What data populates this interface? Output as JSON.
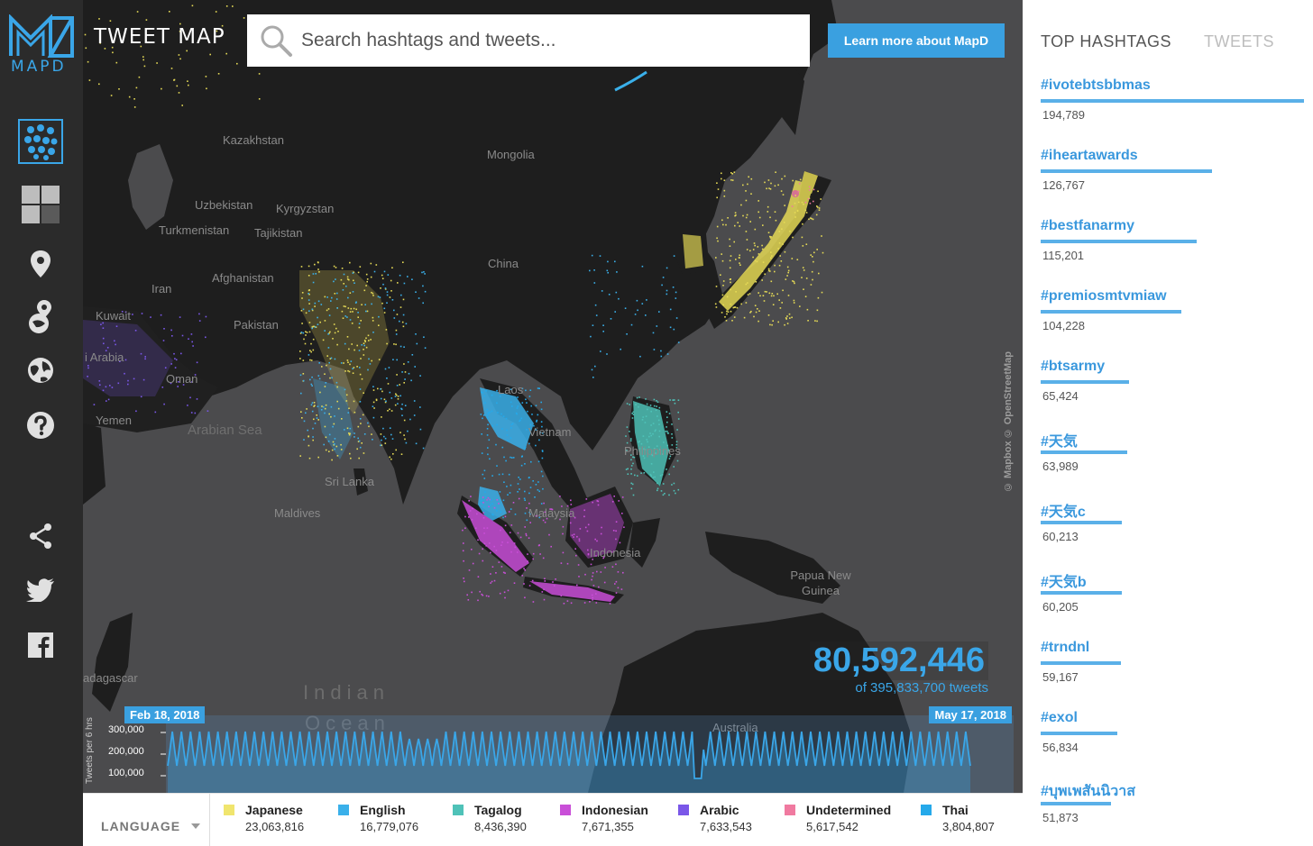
{
  "app": {
    "logo_text": "MAPD",
    "title": "TWEET MAP"
  },
  "search": {
    "placeholder": "Search hashtags and tweets..."
  },
  "header": {
    "learn_more_label": "Learn more about MapD"
  },
  "rail": {
    "items": [
      {
        "name": "heatmap-points-icon",
        "active": true
      },
      {
        "name": "grid-layout-icon"
      },
      {
        "name": "map-pin-icon"
      },
      {
        "name": "location-pin-globe-icon"
      },
      {
        "name": "globe-icon"
      },
      {
        "name": "help-icon"
      },
      {
        "name": "share-icon"
      },
      {
        "name": "twitter-icon"
      },
      {
        "name": "facebook-icon"
      }
    ]
  },
  "map": {
    "labels": [
      "Kazakhstan",
      "Mongolia",
      "Uzbekistan",
      "Kyrgyzstan",
      "Turkmenistan",
      "Tajikistan",
      "Afghanistan",
      "China",
      "Iran",
      "Kuwait",
      "Pakistan",
      "i Arabia",
      "Oman",
      "Yemen",
      "Arabian Sea",
      "Laos",
      "Vietnam",
      "Philippines",
      "Sri Lanka",
      "Maldives",
      "Malaysia",
      "Indonesia",
      "Papua New Guinea",
      "adagascar",
      "Australia"
    ],
    "ocean_labels": [
      "Indian",
      "Ocean"
    ],
    "attribution": "© Mapbox   © OpenStreetMap",
    "dot_colors": {
      "japanese": "#e5da56",
      "english": "#3ab0ea",
      "tagalog": "#4fc2b8",
      "indonesian": "#c94fd8",
      "arabic": "#7a57e8",
      "undetermined": "#f07aa0",
      "thai": "#25a9ea"
    }
  },
  "counter": {
    "count": "80,592,446",
    "of_text": "of 395,833,700 tweets"
  },
  "timeline": {
    "start_date": "Feb 18, 2018",
    "end_date": "May 17, 2018",
    "y_axis_label": "Tweets per 6 hrs",
    "y_ticks": [
      "300,000",
      "200,000",
      "100,000"
    ]
  },
  "legend": {
    "label": "LANGUAGE",
    "items": [
      {
        "name": "Japanese",
        "count": "23,063,816",
        "color": "#f0e56e"
      },
      {
        "name": "English",
        "count": "16,779,076",
        "color": "#3ab0ea"
      },
      {
        "name": "Tagalog",
        "count": "8,436,390",
        "color": "#4fc2b8"
      },
      {
        "name": "Indonesian",
        "count": "7,671,355",
        "color": "#c94fd8"
      },
      {
        "name": "Arabic",
        "count": "7,633,543",
        "color": "#7a57e8"
      },
      {
        "name": "Undetermined",
        "count": "5,617,542",
        "color": "#f07aa0"
      },
      {
        "name": "Thai",
        "count": "3,804,807",
        "color": "#25a9ea"
      }
    ]
  },
  "panel": {
    "tabs": [
      {
        "label": "TOP HASHTAGS",
        "active": true
      },
      {
        "label": "TWEETS",
        "active": false
      }
    ],
    "hashtags": [
      {
        "tag": "#ivotebtsbbmas",
        "count": "194,789",
        "value": 194789
      },
      {
        "tag": "#iheartawards",
        "count": "126,767",
        "value": 126767
      },
      {
        "tag": "#bestfanarmy",
        "count": "115,201",
        "value": 115201
      },
      {
        "tag": "#premiosmtvmiaw",
        "count": "104,228",
        "value": 104228
      },
      {
        "tag": "#btsarmy",
        "count": "65,424",
        "value": 65424
      },
      {
        "tag": "#天気",
        "count": "63,989",
        "value": 63989
      },
      {
        "tag": "#天気c",
        "count": "60,213",
        "value": 60213
      },
      {
        "tag": "#天気b",
        "count": "60,205",
        "value": 60205
      },
      {
        "tag": "#trndnl",
        "count": "59,167",
        "value": 59167
      },
      {
        "tag": "#exol",
        "count": "56,834",
        "value": 56834
      },
      {
        "tag": "#บุพเพสันนิวาส",
        "count": "51,873",
        "value": 51873
      }
    ]
  }
}
